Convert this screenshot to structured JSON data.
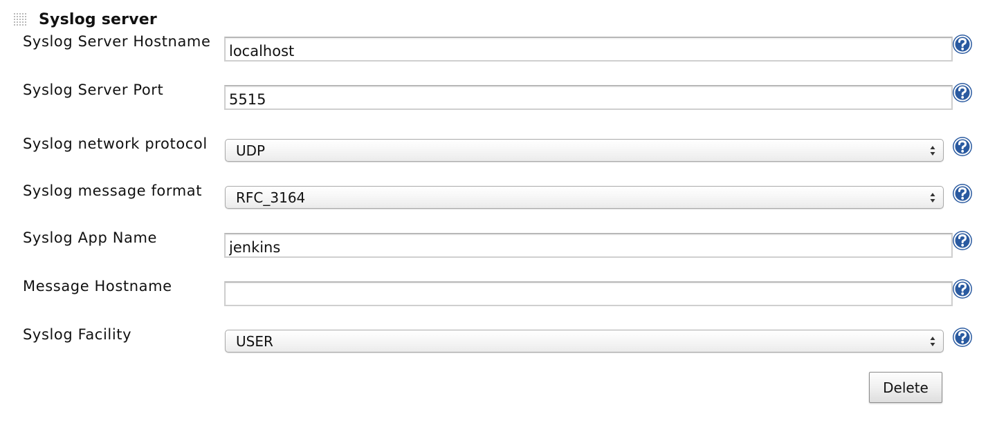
{
  "section": {
    "title": "Syslog server"
  },
  "fields": {
    "hostname": {
      "label": "Syslog Server Hostname",
      "value": "localhost"
    },
    "port": {
      "label": "Syslog Server Port",
      "value": "5515"
    },
    "protocol": {
      "label": "Syslog network protocol",
      "selected": "UDP"
    },
    "format": {
      "label": "Syslog message format",
      "selected": "RFC_3164"
    },
    "app_name": {
      "label": "Syslog App Name",
      "value": "jenkins"
    },
    "message_hostname": {
      "label": "Message Hostname",
      "value": ""
    },
    "facility": {
      "label": "Syslog Facility",
      "selected": "USER"
    }
  },
  "actions": {
    "delete_label": "Delete"
  },
  "icons": {
    "grip": "drag-handle-icon",
    "help": "help-question-icon",
    "select_arrows": "up-down-arrows-icon"
  },
  "colors": {
    "help_icon": "#2f5fa8",
    "text": "#111111",
    "field_border": "#cfcfcf"
  }
}
